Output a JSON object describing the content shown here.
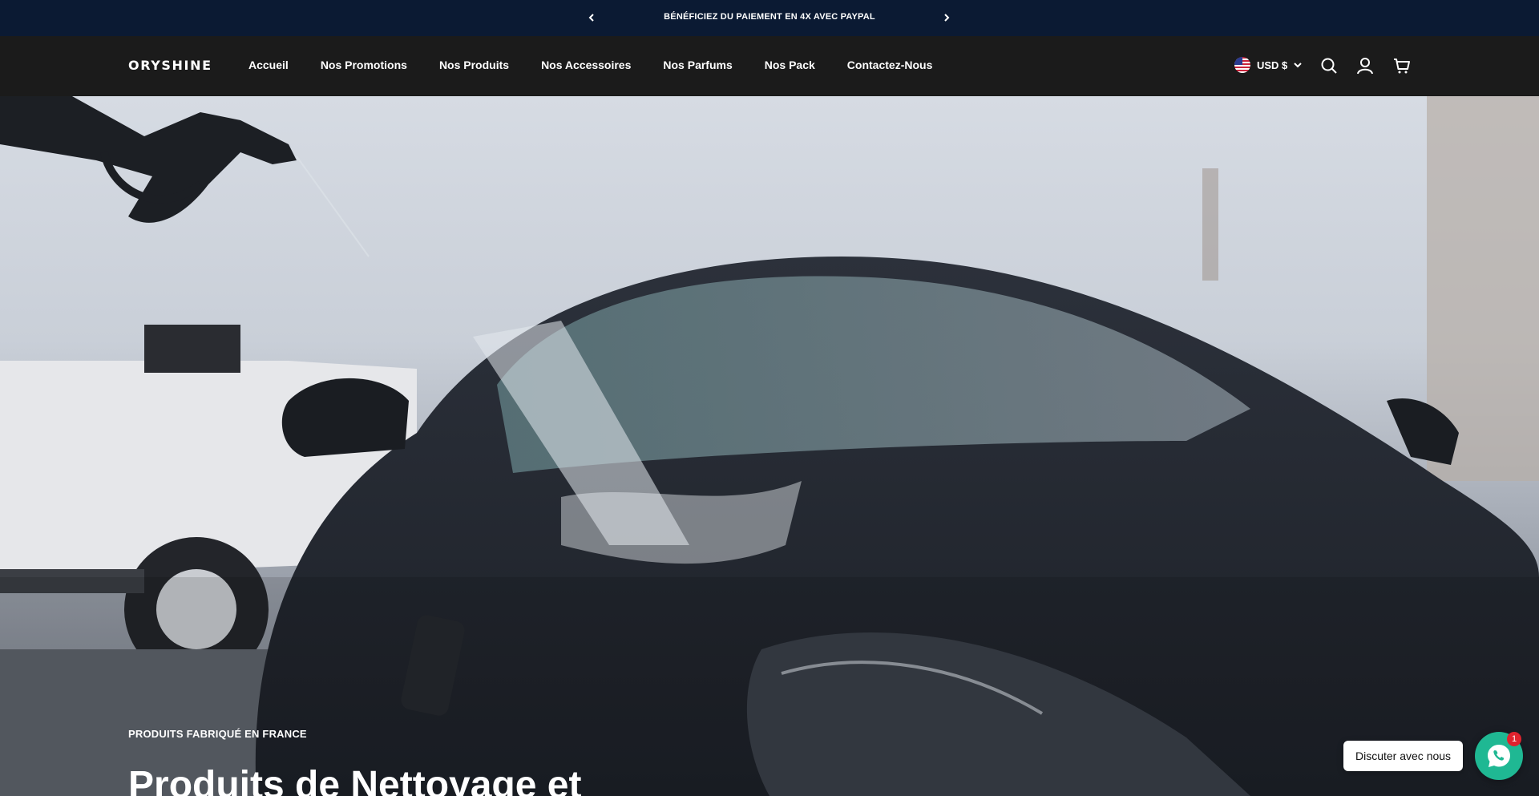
{
  "announcement": {
    "message": "BÉNÉFICIEZ DU PAIEMENT EN 4X AVEC PAYPAL",
    "prev_icon": "chevron-left-icon",
    "next_icon": "chevron-right-icon"
  },
  "header": {
    "logo": "ORYSHINE",
    "nav": [
      {
        "label": "Accueil"
      },
      {
        "label": "Nos Promotions"
      },
      {
        "label": "Nos Produits"
      },
      {
        "label": "Nos Accessoires"
      },
      {
        "label": "Nos Parfums"
      },
      {
        "label": "Nos Pack"
      },
      {
        "label": "Contactez-Nous"
      }
    ],
    "currency": "USD $",
    "icons": [
      "us-flag-icon",
      "chevron-down-icon",
      "search-icon",
      "account-icon",
      "cart-icon"
    ]
  },
  "hero": {
    "eyebrow": "PRODUITS FABRIQUÉ EN FRANCE",
    "title": "Produits de Nettoyage et"
  },
  "chat": {
    "label": "Discuter avec nous",
    "badge": "1",
    "icon": "whatsapp-icon"
  },
  "colors": {
    "announcement_bg": "#0b1a33",
    "header_bg": "#1b1b1b",
    "chat_green": "#1fb893",
    "badge_red": "#e0232e"
  }
}
